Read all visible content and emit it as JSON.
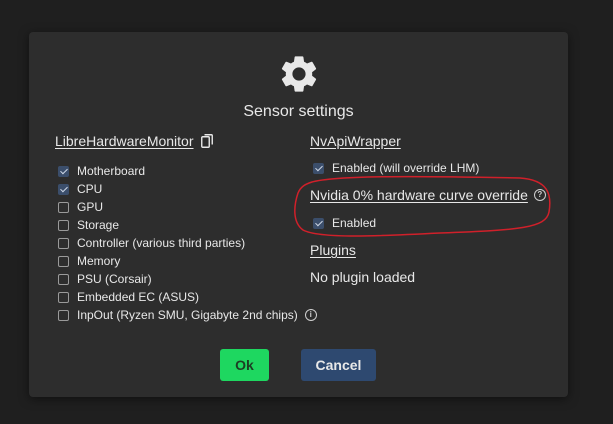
{
  "dialog": {
    "title": "Sensor settings",
    "icon": "gear-icon",
    "lhm": {
      "heading": "LibreHardwareMonitor",
      "copy_icon": "copy-icon",
      "items": [
        {
          "label": "Motherboard",
          "checked": true
        },
        {
          "label": "CPU",
          "checked": true
        },
        {
          "label": "GPU",
          "checked": false
        },
        {
          "label": "Storage",
          "checked": false
        },
        {
          "label": "Controller (various third parties)",
          "checked": false
        },
        {
          "label": "Memory",
          "checked": false
        },
        {
          "label": "PSU (Corsair)",
          "checked": false
        },
        {
          "label": "Embedded EC (ASUS)",
          "checked": false
        },
        {
          "label": "InpOut (Ryzen SMU, Gigabyte 2nd chips)",
          "checked": false
        }
      ]
    },
    "nvapi": {
      "heading": "NvApiWrapper",
      "enabled_label": "Enabled (will override LHM)",
      "enabled_checked": true,
      "curve_heading": "Nvidia 0% hardware curve override",
      "curve_enabled_label": "Enabled",
      "curve_enabled_checked": true
    },
    "plugins": {
      "heading": "Plugins",
      "status": "No plugin loaded"
    },
    "buttons": {
      "ok": "Ok",
      "cancel": "Cancel"
    }
  },
  "colors": {
    "background": "#1f1f1f",
    "dialog": "#2d2d2d",
    "ok_button": "#1ed760",
    "cancel_button": "#2e4970",
    "checkbox_checked": "#3b4e6b",
    "annotation": "#d0202a"
  }
}
